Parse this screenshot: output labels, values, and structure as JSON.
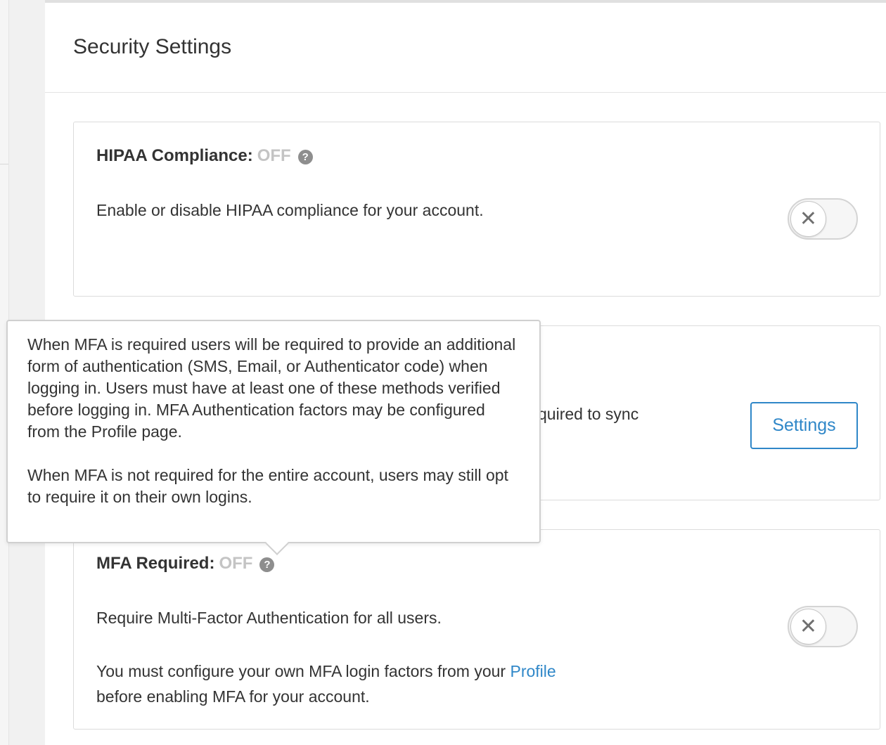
{
  "page": {
    "title": "Security Settings"
  },
  "hipaa": {
    "title": "HIPAA Compliance:",
    "status": "OFF",
    "help_icon": "question-circle",
    "description": "Enable or disable HIPAA compliance for your account.",
    "toggle_state": "off"
  },
  "sync": {
    "description_fragment": "quired to sync",
    "settings_label": "Settings"
  },
  "tooltip": {
    "paragraph1": "When MFA is required users will be required to provide an additional form of authentication (SMS, Email, or Authenticator code) when logging in. Users must have at least one of these methods verified before logging in. MFA Authentication factors may be configured from the Profile page.",
    "paragraph2": "When MFA is not required for the entire account, users may still opt to require it on their own logins."
  },
  "mfa": {
    "title": "MFA Required:",
    "status": "OFF",
    "help_icon": "question-circle",
    "description": "Require Multi-Factor Authentication for all users.",
    "note_before_link": "You must configure your own MFA login factors from your",
    "link_text": "Profile",
    "note_after_link": "before enabling MFA for your account.",
    "toggle_state": "off"
  },
  "colors": {
    "accent": "#2f87c8",
    "status_off": "#c4c4c4",
    "border": "#dcdcdc"
  }
}
